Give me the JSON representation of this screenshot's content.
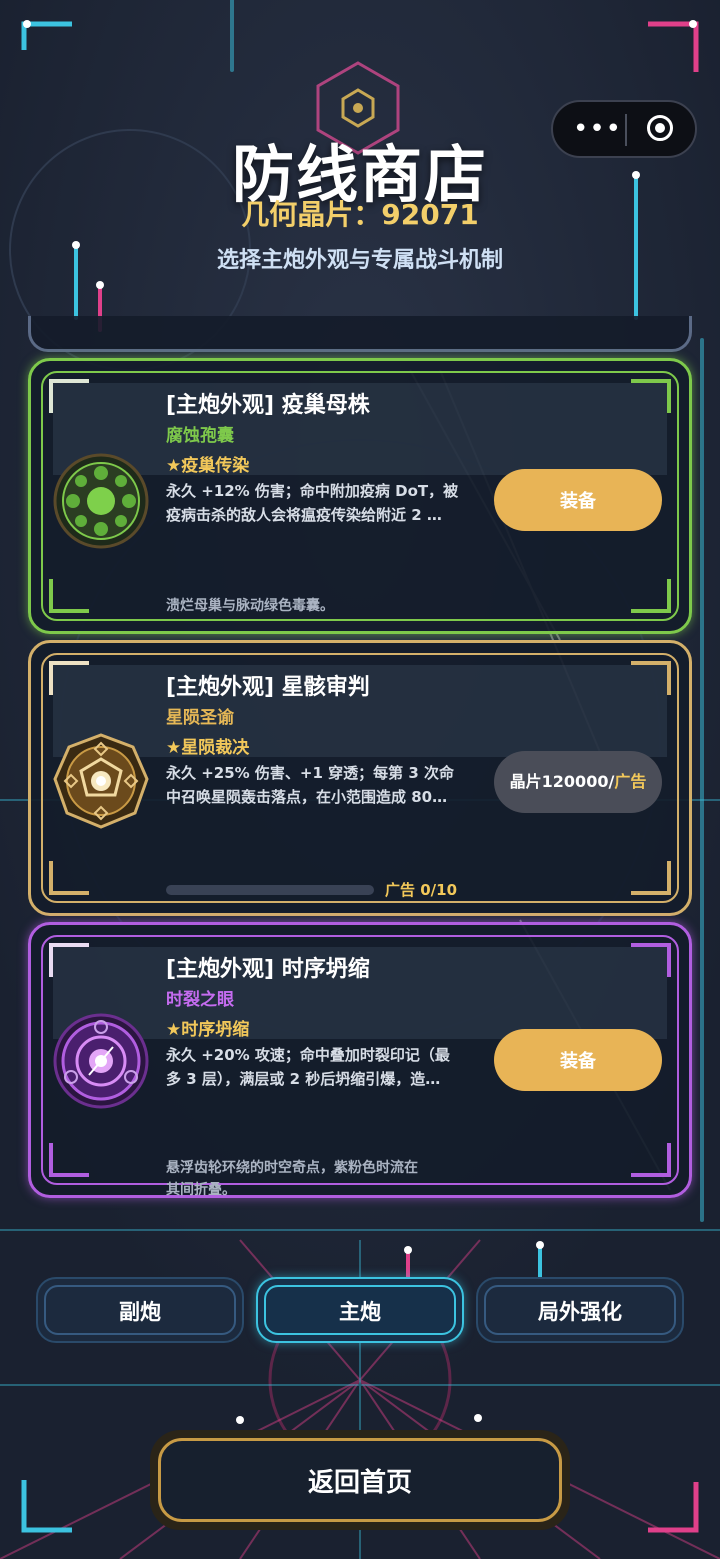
{
  "header": {
    "title": "防线商店",
    "crystals": "几何晶片：92071",
    "subtitle": "选择主炮外观与专属战斗机制"
  },
  "cards": [
    {
      "name": "[主炮外观] 疫巢母株",
      "sub": "腐蚀孢囊",
      "skill": "★疫巢传染",
      "desc_line1": "永久 +12% 伤害；命中附加疫病 DoT，被",
      "desc_line2": "疫病击杀的敌人会将瘟疫传染给附近 2 …",
      "flavor": "溃烂母巢与脉动绿色毒囊。",
      "button": "装备",
      "accent": "#7ec94b",
      "icon": "plague-nest-icon"
    },
    {
      "name": "[主炮外观] 星骸审判",
      "sub": "星陨圣谕",
      "skill": "★星陨裁决",
      "desc_line1": "永久 +25% 伤害、+1 穿透；每第 3 次命",
      "desc_line2": "中召唤星陨轰击落点，在小范围造成 80…",
      "button_main": "晶片120000/",
      "button_ad": "广告",
      "progress_label": "广告 0/10",
      "progress": 0,
      "accent": "#d4b06a",
      "icon": "star-judgment-icon"
    },
    {
      "name": "[主炮外观] 时序坍缩",
      "sub": "时裂之眼",
      "skill": "★时序坍缩",
      "desc_line1": "永久 +20% 攻速；命中叠加时裂印记（最",
      "desc_line2": "多 3 层），满层或 2 秒后坍缩引爆，造…",
      "flavor_line1": "悬浮齿轮环绕的时空奇点，紫粉色时流在",
      "flavor_line2": "其间折叠。",
      "button": "装备",
      "accent": "#b15ee0",
      "icon": "time-collapse-icon"
    }
  ],
  "tabs": [
    {
      "label": "副炮",
      "active": false
    },
    {
      "label": "主炮",
      "active": true
    },
    {
      "label": "局外强化",
      "active": false
    }
  ],
  "home_button": "返回首页"
}
